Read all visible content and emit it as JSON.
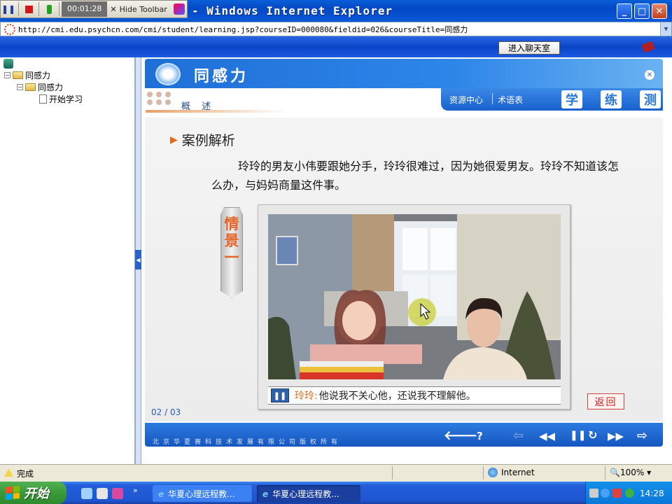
{
  "recorder": {
    "time": "00:01:28",
    "hide_label": "Hide Toolbar"
  },
  "window": {
    "title": "- Windows Internet Explorer",
    "min": "_",
    "max": "□",
    "close": "✕"
  },
  "address": {
    "url": "http://cmi.edu.psychcn.com/cmi/student/learning.jsp?courseID=000080&fieldid=026&courseTitle=同感力"
  },
  "header": {
    "chat_label": "进入聊天室"
  },
  "tree": {
    "root": "同感力",
    "child": "同感力",
    "leaf": "开始学习"
  },
  "course": {
    "title": "同感力",
    "subtitle": "概 述",
    "links": [
      "资源中心",
      "术语表"
    ],
    "big_tabs": [
      "学",
      "练",
      "测"
    ],
    "section_title": "案例解析",
    "paragraph": "玲玲的男友小伟要跟她分手，玲玲很难过，因为她很爱男友。玲玲不知道该怎么办，与妈妈商量这件事。",
    "scene_label": "情景一",
    "speaker": "玲玲:",
    "subtitle_line": "他说我不关心他，还说我不理解他。",
    "back_label": "返回",
    "page": "02 / 03",
    "copyright": "北京华夏赛科技术发展有限公司版权所有"
  },
  "controls": {
    "prev": "🡐",
    "help": "?",
    "back_dim": "⇦",
    "rewind": "◀◀",
    "pause": "❚❚",
    "replay": "↻",
    "forward": "▶▶",
    "next": "⇨"
  },
  "status": {
    "done": "完成",
    "zone": "Internet",
    "zoom": "100%"
  },
  "taskbar": {
    "start": "开始",
    "tasks": [
      "华夏心理远程教...",
      "华夏心理远程教..."
    ],
    "clock": "14:28"
  }
}
